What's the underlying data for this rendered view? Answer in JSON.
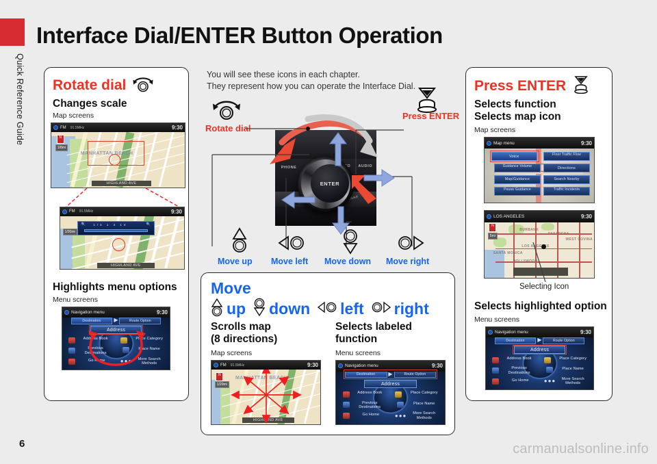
{
  "sidebar": {
    "tab_label": "Quick Reference Guide",
    "accent_color": "#d82c33"
  },
  "header": {
    "title": "Interface Dial/ENTER Button Operation"
  },
  "footer": {
    "page_number": "6",
    "watermark": "carmanualsonline.info"
  },
  "intro": {
    "line1": "You will see these icons in each chapter.",
    "line2": "They represent how you can operate the Interface Dial."
  },
  "colors": {
    "red": "#ef3124",
    "blue": "#1565f0",
    "black": "#111111"
  },
  "diagram": {
    "callouts": [
      {
        "name": "rotate-dial",
        "label": "Rotate dial",
        "color": "#ef3124"
      },
      {
        "name": "press-enter",
        "label": "Press ENTER",
        "color": "#ef3124"
      },
      {
        "name": "move-up",
        "label": "Move up",
        "color": "#1565f0"
      },
      {
        "name": "move-left",
        "label": "Move left",
        "color": "#1565f0"
      },
      {
        "name": "move-down",
        "label": "Move down",
        "color": "#1565f0"
      },
      {
        "name": "move-right",
        "label": "Move right",
        "color": "#1565f0"
      }
    ],
    "dial_labels": {
      "center": "ENTER",
      "phone": "PHONE",
      "info": "INFO",
      "audio": "AUDIO",
      "menu": "MENU",
      "day_night": "DAY/NIGHT"
    }
  },
  "panel_rotate": {
    "heading": "Rotate dial",
    "icon": "rotate-dial-icon",
    "items": [
      {
        "title": "Changes scale",
        "sub": "Map screens"
      },
      {
        "title": "Highlights menu options",
        "sub": "Menu screens"
      }
    ]
  },
  "panel_move": {
    "heading": "Move",
    "directions": [
      {
        "icon": "dial-up-icon",
        "label": "up"
      },
      {
        "icon": "dial-down-icon",
        "label": "down"
      },
      {
        "icon": "dial-left-icon",
        "label": "left"
      },
      {
        "icon": "dial-right-icon",
        "label": "right"
      }
    ],
    "columns": [
      {
        "title_line1": "Scrolls map",
        "title_line2": "(8 directions)",
        "sub": "Map screens"
      },
      {
        "title_line1": "Selects labeled",
        "title_line2": "function",
        "sub": "Menu screens"
      }
    ]
  },
  "panel_enter": {
    "heading": "Press ENTER",
    "icon": "press-enter-icon",
    "items": [
      {
        "title_line1": "Selects function",
        "title_line2": "Selects map icon",
        "sub": "Map screens"
      },
      {
        "title_line1": "Selects highlighted option",
        "title_line2": "",
        "sub": "Menu screens"
      }
    ],
    "map_icon_caption": "Selecting Icon"
  },
  "screens": {
    "map_fm": {
      "band": "FM",
      "freq": "91.5MHz",
      "clock": "9:30",
      "scale_wide": "1/8mi",
      "scale_zoom": "1/20mi",
      "place_label": "MANHATTAN BEACH",
      "street": "HIGHLAND AVE"
    },
    "nav_menu": {
      "title": "Navigation menu",
      "clock": "9:30",
      "tabs": [
        "Destination",
        "Route Option"
      ],
      "highlighted": "Address",
      "options": [
        "Address Book",
        "Place Category",
        "Previous Destinations",
        "Place Name",
        "Go Home",
        "More Search Methods"
      ]
    },
    "map_menu": {
      "title": "Map menu",
      "clock": "9:30",
      "highlighted": "Voice",
      "options": [
        "Voice",
        "Floor Traffic Flow",
        "Guidance Volume",
        "Directions",
        "Map/Guidance",
        "Search Nearby",
        "Pause Guidance",
        "Traffic Incidents"
      ]
    },
    "map_la": {
      "title": "LOS ANGELES",
      "clock": "9:30",
      "scale": "5mi",
      "labels": [
        "BURBANK",
        "PASADENA",
        "LOS ANGELES",
        "SANTA MONICA",
        "HOLLYWOOD",
        "WEST COVINA"
      ]
    }
  }
}
